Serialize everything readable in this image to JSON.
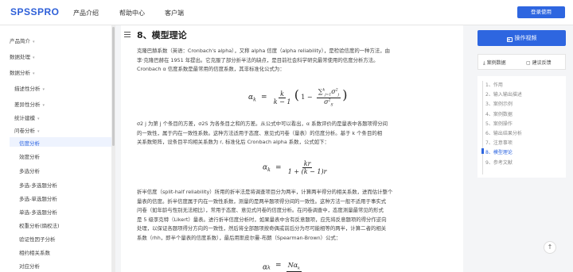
{
  "header": {
    "logo": "SPSSPRO",
    "nav": [
      "产品介绍",
      "帮助中心",
      "客户端"
    ],
    "login_label": "登录使用"
  },
  "sidebar": {
    "items": [
      {
        "label": "产品简介",
        "chev": true
      },
      {
        "label": "数据处理",
        "chev": true
      },
      {
        "label": "数据分析",
        "chev": true
      },
      {
        "label": "描述性分析",
        "chev": true
      },
      {
        "label": "差异性分析",
        "chev": true
      },
      {
        "label": "统计建模",
        "chev": true
      },
      {
        "label": "问卷分析",
        "chev": true
      },
      {
        "label": "信度分析",
        "chev": false
      },
      {
        "label": "效度分析",
        "chev": false
      },
      {
        "label": "多选分析",
        "chev": false
      },
      {
        "label": "多选-多选题分析",
        "chev": false
      },
      {
        "label": "多选-单选题分析",
        "chev": false
      },
      {
        "label": "单选-多选题分析",
        "chev": false
      },
      {
        "label": "权重分析(熵权法)",
        "chev": false
      },
      {
        "label": "验证性因子分析",
        "chev": false
      },
      {
        "label": "相约相关系数",
        "chev": false
      },
      {
        "label": "对应分析",
        "chev": false
      }
    ],
    "active_index": 7
  },
  "content": {
    "section_title": "8、模型理论",
    "para1": [
      "克隆巴赫系数（英语：Cronbach's alpha），又称 alpha 信度（alpha reliability），是检验信度的一种方法，由",
      "李·克隆巴赫在 1951 年提出。它克服了部分折半法的缺点，是目前社会科学研究最常使用的信度分析方法。",
      "Cronbach α 信度系数是最常用的信度系数，其非标准化公式为："
    ],
    "para2": [
      "σ2 j 为第 j 个条目的方差，σ2S 为各条目之和的方差。从公式中可以看出，α 系数评价的是量表中各题项得分间",
      "的一致性，属于内在一致性系数。这种方法适用于态度、意见式问卷（量表）的信度分析。基于 k 个条目的相",
      "关系数矩阵，设条目平均相关系数为 r, 标准化后 Cronbach alpha 系数，公式如下："
    ],
    "para3": [
      "折半信度（split-half reliability）所用的折半法是将调查项目分为两半，计算两半得分的相关系数，进而估计整个",
      "量表的信度。折半信度属于内在一致性系数，测量的是两半题项得分间的一致性。这种方法一般不适用于事实式",
      "问卷（如年龄与性别无法相比），常用于态度、意见式问卷的信度分析。在问卷调查中，态度测量最常见的形式",
      "是 5 级李克特（Likert）量表。进行折半信度分析时，如果量表中含有反意题项，应先将反意题项的得分作逆向",
      "处理，以保证各题项得分方向的一致性，然后将全部题项按奇偶或前后分为尽可能相等的两半，计算二者的相关",
      "系数（rhh，即半个量表的信度系数），最后用斯皮尔曼-布朗（Spearman-Brown）公式："
    ],
    "formula1": {
      "lhs": "α",
      "sub": "k",
      "eq": "=",
      "k": "k",
      "km1": "k − 1",
      "one": "1 −",
      "sum_num": "∑",
      "sig": "σ",
      "sumsub": "j=1",
      "sumsup": "k",
      "jsub": "j",
      "s2": "2",
      "ssub": "S"
    },
    "formula2": {
      "lhs": "α",
      "sub": "k",
      "eq": "=",
      "num": "kr",
      "den": "1 + (k − 1)r"
    },
    "formula3": {
      "lhs": "α",
      "sub": "k",
      "eq": "=",
      "num": "Nα",
      "numsub": "k"
    }
  },
  "right": {
    "op_label": "操作视频",
    "case_data": "案例数据",
    "feedback": "建议反馈",
    "toc": [
      "1、作用",
      "2、输入输出描述",
      "3、案例示例",
      "4、案例数据",
      "5、案例操作",
      "6、输出结果分析",
      "7、注意事项",
      "8、模型理论",
      "9、参考文献"
    ],
    "toc_active": 7,
    "back_top": "↑"
  }
}
